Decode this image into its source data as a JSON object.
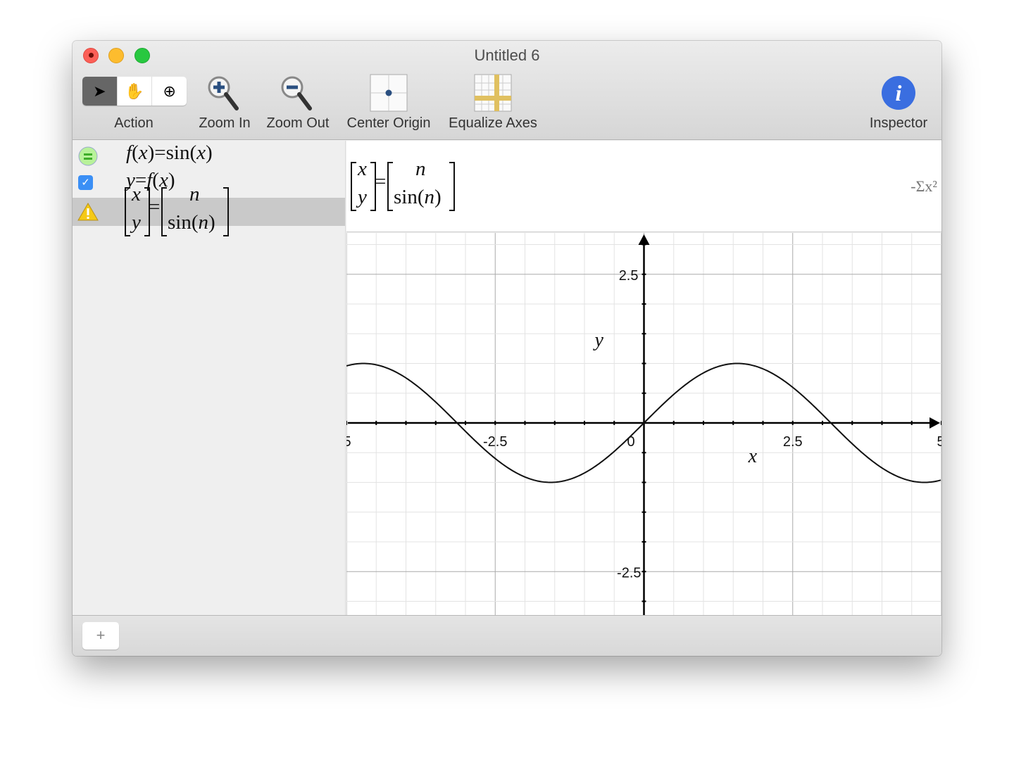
{
  "window": {
    "title": "Untitled 6"
  },
  "toolbar": {
    "action": "Action",
    "zoom_in": "Zoom In",
    "zoom_out": "Zoom Out",
    "center_origin": "Center Origin",
    "equalize_axes": "Equalize Axes",
    "inspector": "Inspector"
  },
  "sidebar": {
    "items": [
      {
        "icon": "equals-icon",
        "eq": {
          "f": "f",
          "x": "x",
          "eq": ")=sin(",
          "lp": "(",
          "rp": ")"
        }
      },
      {
        "icon": "checkbox-icon",
        "eq": {
          "y": "y",
          "eq": "=",
          "f": "f",
          "lp": "(",
          "x": "x",
          "rp": ")"
        }
      },
      {
        "icon": "warning-icon",
        "eq": {
          "x": "x",
          "y": "y",
          "n": "n",
          "sin": "sin(",
          "n2": "n",
          "rp": ")",
          "eq": "="
        }
      }
    ]
  },
  "display": {
    "x": "x",
    "y": "y",
    "n": "n",
    "sin": "sin(",
    "n2": "n",
    "rp": ")",
    "eq": "=",
    "expr_icon": "-Σx²"
  },
  "bottom": {
    "add": "+"
  },
  "chart_data": {
    "type": "line",
    "function": "sin(x)",
    "xlim": [
      -5,
      5
    ],
    "ylim": [
      -3.2,
      3.2
    ],
    "xlabel": "x",
    "ylabel": "y",
    "xticks": [
      "-2.5",
      "0",
      "2.5"
    ],
    "xticks_edge": [
      "5",
      "5"
    ],
    "yticks": [
      "2.5",
      "-2.5"
    ],
    "grid": true,
    "minor_step": 0.5,
    "major_step": 2.5
  }
}
